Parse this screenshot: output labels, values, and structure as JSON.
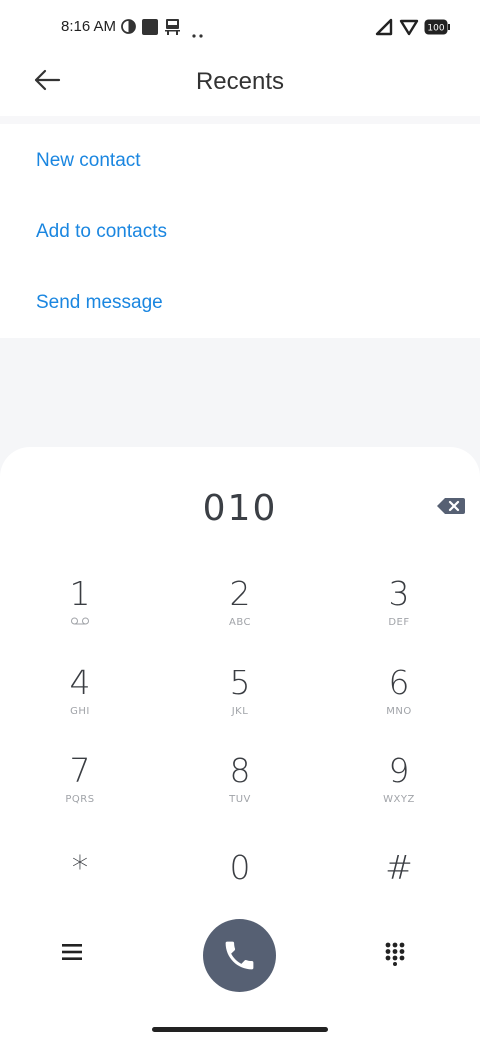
{
  "status_bar": {
    "time": "8:16 AM",
    "icons": [
      "data-saver-icon",
      "square-notification-icon",
      "transit-icon",
      "more-dots-icon"
    ],
    "right_icons": [
      "signal-icon",
      "wifi-icon",
      "battery-icon"
    ],
    "battery": "100"
  },
  "header": {
    "title": "Recents",
    "back_icon": "arrow-left-icon"
  },
  "actions": [
    {
      "label": "New contact"
    },
    {
      "label": "Add to contacts"
    },
    {
      "label": "Send message"
    }
  ],
  "dialer": {
    "number": "010",
    "backspace_icon": "backspace-icon",
    "keys": [
      {
        "digit": "1",
        "letters": ""
      },
      {
        "digit": "2",
        "letters": "ABC"
      },
      {
        "digit": "3",
        "letters": "DEF"
      },
      {
        "digit": "4",
        "letters": "GHI"
      },
      {
        "digit": "5",
        "letters": "JKL"
      },
      {
        "digit": "6",
        "letters": "MNO"
      },
      {
        "digit": "7",
        "letters": "PQRS"
      },
      {
        "digit": "8",
        "letters": "TUV"
      },
      {
        "digit": "9",
        "letters": "WXYZ"
      },
      {
        "digit": "*",
        "letters": ""
      },
      {
        "digit": "0",
        "letters": ""
      },
      {
        "digit": "#",
        "letters": ""
      }
    ],
    "bottom_icons": [
      "menu-icon",
      "phone-icon",
      "keypad-icon"
    ]
  },
  "colors": {
    "accent": "#1a86e0",
    "call_button": "#566073",
    "backspace": "#566073"
  }
}
